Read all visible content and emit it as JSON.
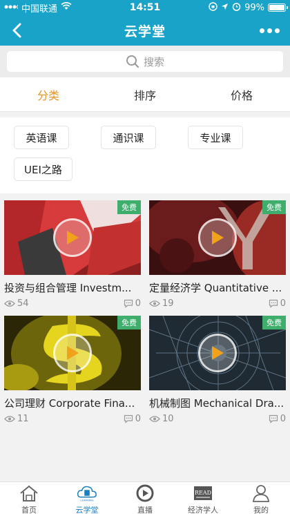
{
  "status": {
    "carrier": "中国联通",
    "time": "14:51",
    "battery": "99%",
    "battery_level": 0.99
  },
  "header": {
    "title": "云学堂"
  },
  "search": {
    "placeholder": "搜索"
  },
  "tabs": [
    {
      "label": "分类",
      "active": true
    },
    {
      "label": "排序",
      "active": false
    },
    {
      "label": "价格",
      "active": false
    }
  ],
  "categories": [
    "英语课",
    "通识课",
    "专业课",
    "UEI之路"
  ],
  "courses": [
    {
      "title": "投资与组合管理 Investm...",
      "badge": "免费",
      "views": "54",
      "comments": "0"
    },
    {
      "title": "定量经济学 Quantitative ...",
      "badge": "免费",
      "views": "19",
      "comments": "0"
    },
    {
      "title": "公司理财 Corporate Fina...",
      "badge": "免费",
      "views": "11",
      "comments": "0"
    },
    {
      "title": "机械制图 Mechanical Dra...",
      "badge": "免费",
      "views": "10",
      "comments": "0"
    }
  ],
  "bottom_nav": [
    {
      "label": "首页",
      "icon": "home-icon"
    },
    {
      "label": "云学堂",
      "icon": "cloud-learning-icon",
      "active": true
    },
    {
      "label": "直播",
      "icon": "live-icon"
    },
    {
      "label": "经济学人",
      "icon": "read-icon"
    },
    {
      "label": "我的",
      "icon": "profile-icon"
    }
  ],
  "colors": {
    "primary": "#1aa3c9",
    "active_tab": "#e8921d",
    "badge": "#3fae6d",
    "bottom_active": "#1a7fc0"
  },
  "icons": {
    "logo_text": "LEARNING",
    "read_text": "READ"
  }
}
